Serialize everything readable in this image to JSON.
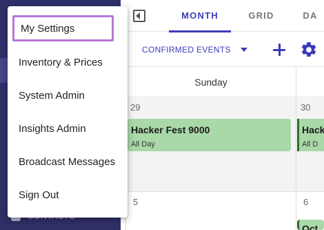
{
  "sidebar": {
    "contacts_label": "CONTACTS"
  },
  "calendar": {
    "tabs": [
      "MONTH",
      "GRID",
      "DA"
    ],
    "active_tab": "MONTH",
    "filter_label": "CONFIRMED EVENTS",
    "day_of_week": "Sunday",
    "dates": [
      "29",
      "30",
      "5",
      "6"
    ],
    "events": [
      {
        "title": "Hacker Fest 9000",
        "subtitle": "All Day",
        "color": "#a9d8a9"
      },
      {
        "title": "Hack",
        "subtitle": "All D",
        "color": "#a9d8a9"
      },
      {
        "title": "Oct",
        "subtitle": "",
        "color": "#a9d8a9"
      }
    ]
  },
  "menu": {
    "items": [
      "My Settings",
      "Inventory & Prices",
      "System Admin",
      "Insights Admin",
      "Broadcast Messages",
      "Sign Out"
    ],
    "focused_item": "My Settings",
    "focus_color": "#b877d8"
  },
  "colors": {
    "accent": "#3b3bb9",
    "sidebar": "#2f2f68",
    "event_green": "#a9d8a9"
  }
}
